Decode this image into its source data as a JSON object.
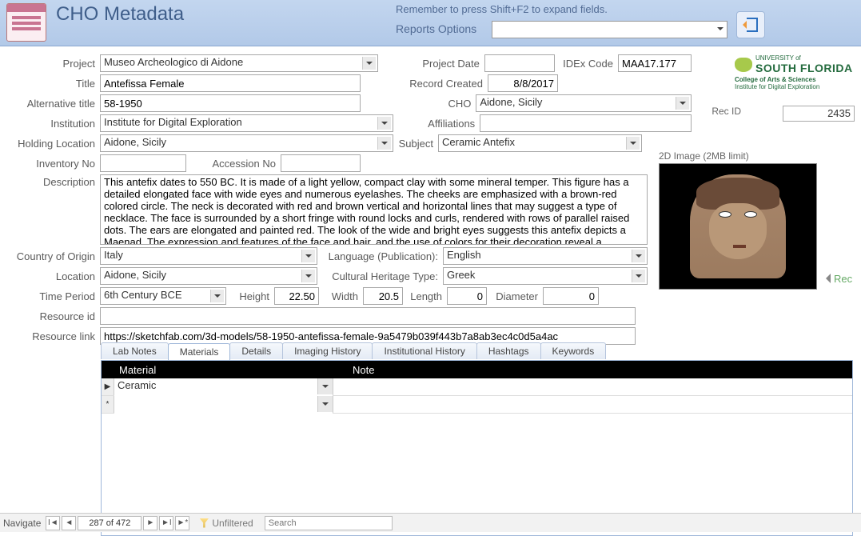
{
  "header": {
    "title": "CHO Metadata",
    "hint": "Remember to press Shift+F2 to expand fields.",
    "reports_label": "Reports Options",
    "reports_value": ""
  },
  "labels": {
    "project": "Project",
    "title": "Title",
    "alt_title": "Alternative title",
    "institution": "Institution",
    "holding": "Holding Location",
    "inventory": "Inventory No",
    "accession": "Accession No",
    "description": "Description",
    "country": "Country of Origin",
    "location": "Location",
    "time_period": "Time Period",
    "height": "Height",
    "width": "Width",
    "length": "Length",
    "diameter": "Diameter",
    "resource_id": "Resource id",
    "resource_link": "Resource link",
    "project_date": "Project Date",
    "idex": "IDEx Code",
    "record_created": "Record Created",
    "cho": "CHO",
    "affiliations": "Affiliations",
    "subject": "Subject",
    "language": "Language (Publication):",
    "cht": "Cultural Heritage Type:",
    "recid": "Rec ID",
    "image_caption": "2D Image (2MB limit)",
    "rec_side": "Rec"
  },
  "logo": {
    "univ_of": "UNIVERSITY of",
    "name": "SOUTH FLORIDA",
    "college": "College of Arts & Sciences",
    "institute": "Institute for Digital Exploration"
  },
  "fields": {
    "project": "Museo Archeologico di Aidone",
    "title": "Antefissa Female",
    "alt_title": "58-1950",
    "institution": "Institute for Digital Exploration",
    "holding": "Aidone, Sicily",
    "inventory": "",
    "accession": "",
    "description": "This antefix dates to 550 BC. It is made of a light yellow, compact clay with some mineral temper. This figure has a detailed elongated face with wide eyes and numerous eyelashes. The cheeks are emphasized with a brown-red colored circle. The neck is decorated with red and brown vertical and horizontal lines that may suggest a type of necklace. The face is surrounded by a short fringe with round locks and curls, rendered with rows of parallel raised dots. The ears are elongated and painted red. The look of the wide and bright eyes suggests this antefix depicts a Maenad. The expression and features of the face and hair, and the use of colors for their decoration reveal a reworking, by local artisans, of",
    "country": "Italy",
    "location": "Aidone, Sicily",
    "time_period": "6th Century BCE",
    "height": "22.50",
    "width": "20.5",
    "length": "0",
    "diameter": "0",
    "resource_id": "",
    "resource_link": "https://sketchfab.com/3d-models/58-1950-antefissa-female-9a5479b039f443b7a8ab3ec4c0d5a4ac",
    "project_date": "",
    "idex": "MAA17.177",
    "record_created": "8/8/2017",
    "cho": "Aidone, Sicily",
    "affiliations": "",
    "subject": "Ceramic Antefix",
    "language": "English",
    "cht": "Greek",
    "recid": "2435"
  },
  "tabs": [
    "Lab Notes",
    "Materials",
    "Details",
    "Imaging History",
    "Institutional  History",
    "Hashtags",
    "Keywords"
  ],
  "active_tab": 1,
  "grid": {
    "headers": {
      "material": "Material",
      "note": "Note"
    },
    "rows": [
      {
        "material": "Ceramic",
        "note": ""
      }
    ],
    "new_row_marker": "*",
    "current_row_marker": "▶"
  },
  "nav": {
    "label": "Navigate",
    "first": "I◄",
    "prev": "◄",
    "next": "►",
    "last": "►I",
    "new": "►*",
    "position": "287 of 472",
    "filter": "Unfiltered",
    "search": "Search"
  }
}
